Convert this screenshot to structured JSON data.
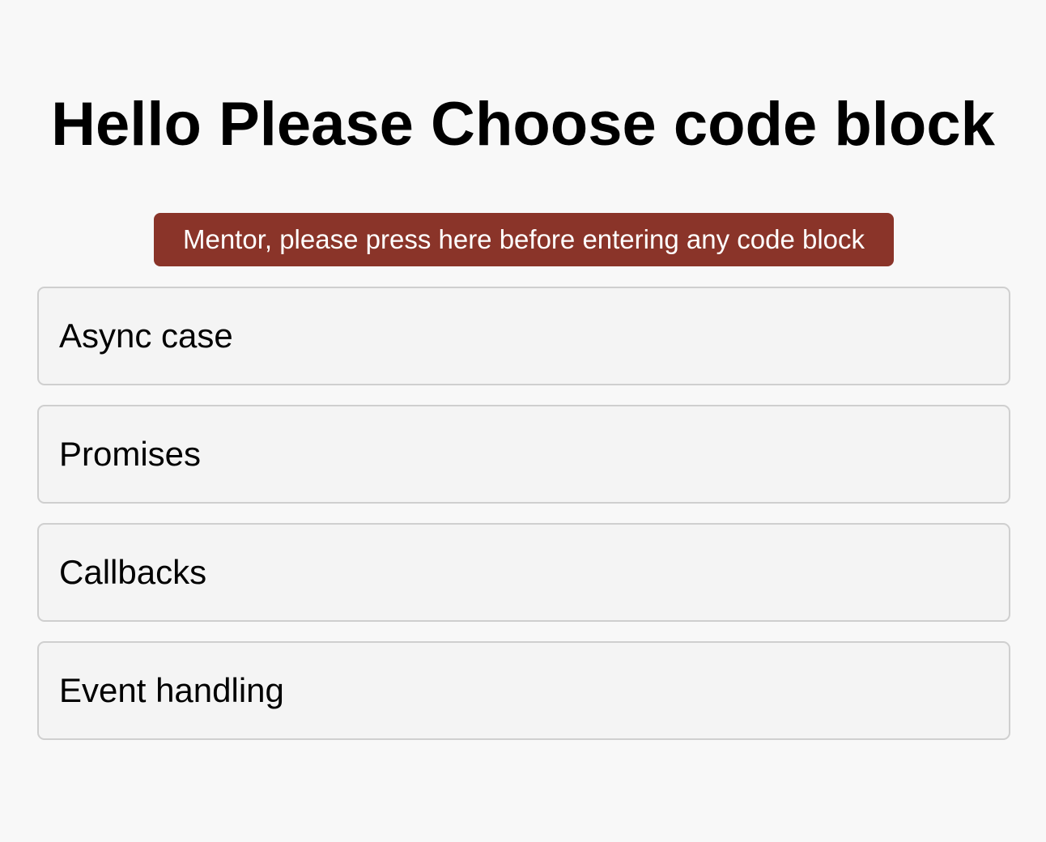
{
  "header": {
    "title": "Hello Please Choose code block"
  },
  "mentor_button": {
    "label": "Mentor, please press here before entering any code block"
  },
  "code_blocks": [
    {
      "label": "Async case"
    },
    {
      "label": "Promises"
    },
    {
      "label": "Callbacks"
    },
    {
      "label": "Event handling"
    }
  ],
  "colors": {
    "background": "#f8f8f8",
    "mentor_button": "#8a3429",
    "card_background": "#f4f4f4",
    "card_border": "#cfcfcf"
  }
}
